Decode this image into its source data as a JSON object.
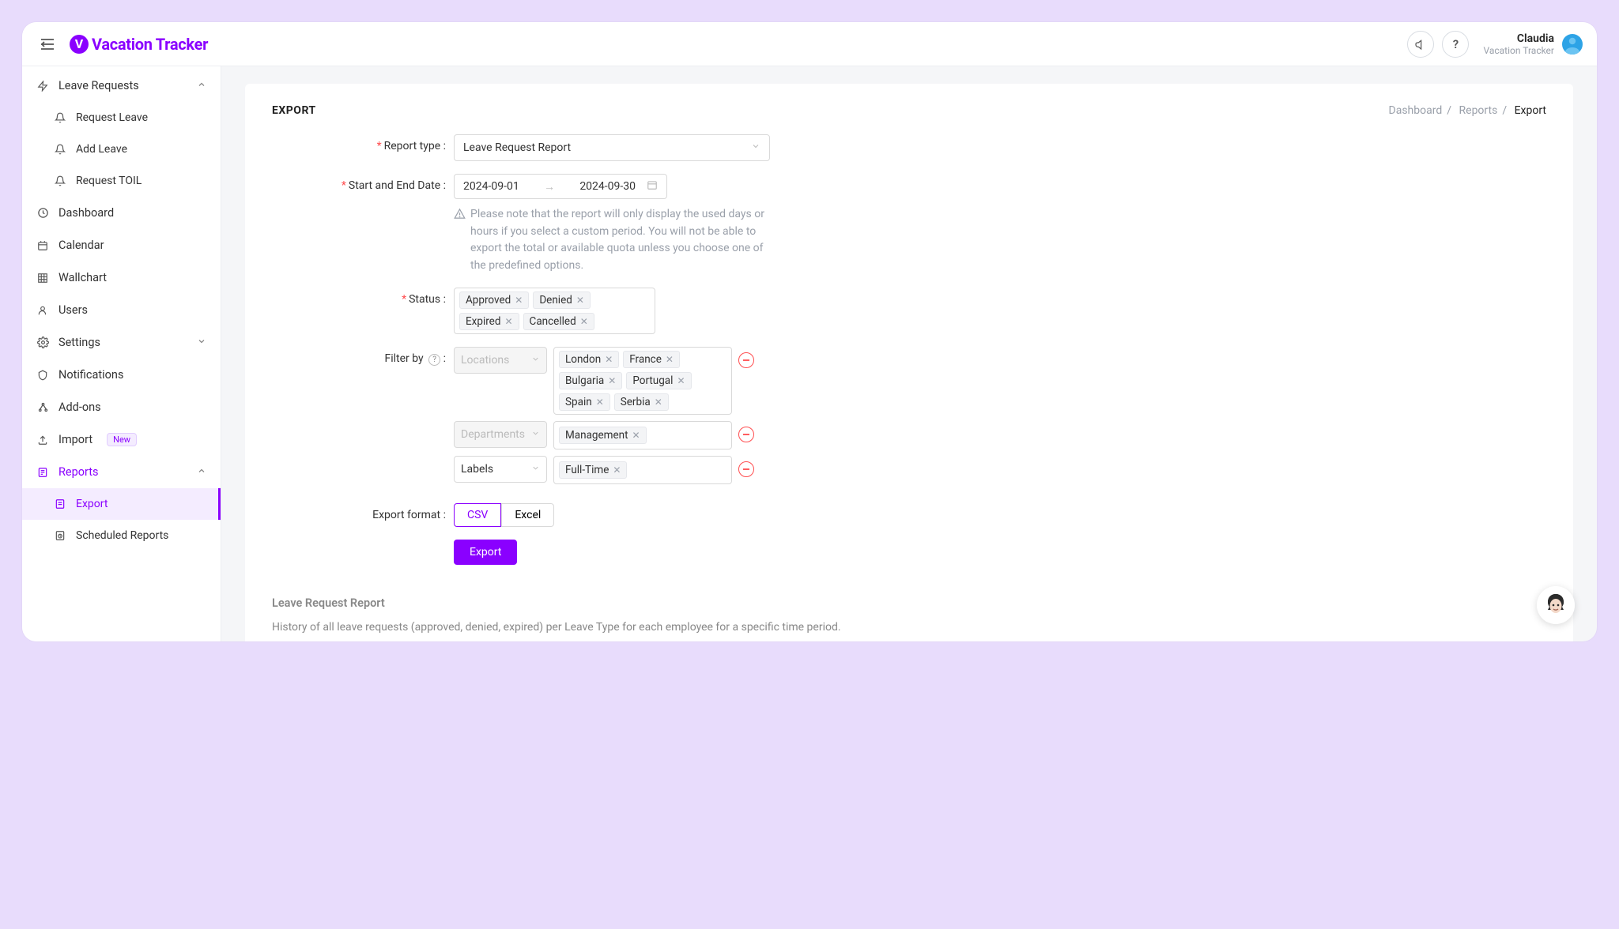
{
  "brand": {
    "name": "Vacation Tracker",
    "mark": "V"
  },
  "user": {
    "name": "Claudia",
    "sub": "Vacation Tracker"
  },
  "sidebar": {
    "leaveRequests": {
      "label": "Leave Requests"
    },
    "requestLeave": {
      "label": "Request Leave"
    },
    "addLeave": {
      "label": "Add Leave"
    },
    "requestToil": {
      "label": "Request TOIL"
    },
    "dashboard": {
      "label": "Dashboard"
    },
    "calendar": {
      "label": "Calendar"
    },
    "wallchart": {
      "label": "Wallchart"
    },
    "users": {
      "label": "Users"
    },
    "settings": {
      "label": "Settings"
    },
    "notifications": {
      "label": "Notifications"
    },
    "addons": {
      "label": "Add-ons"
    },
    "import": {
      "label": "Import",
      "badge": "New"
    },
    "reports": {
      "label": "Reports"
    },
    "export": {
      "label": "Export"
    },
    "scheduled": {
      "label": "Scheduled Reports"
    }
  },
  "breadcrumb": {
    "a": "Dashboard",
    "b": "Reports",
    "c": "Export"
  },
  "page": {
    "title": "EXPORT"
  },
  "form": {
    "reportType": {
      "label": "Report type",
      "value": "Leave Request Report"
    },
    "dateRange": {
      "label": "Start and End Date",
      "start": "2024-09-01",
      "end": "2024-09-30",
      "note": "Please note that the report will only display the used days or hours if you select a custom period. You will not be able to export the total or available quota unless you choose one of the predefined options."
    },
    "status": {
      "label": "Status",
      "tags": [
        "Approved",
        "Denied",
        "Expired",
        "Cancelled"
      ]
    },
    "filterBy": {
      "label": "Filter by"
    },
    "filters": [
      {
        "type": "Locations",
        "disabled": true,
        "values": [
          "London",
          "France",
          "Bulgaria",
          "Portugal",
          "Spain",
          "Serbia"
        ]
      },
      {
        "type": "Departments",
        "disabled": true,
        "values": [
          "Management"
        ]
      },
      {
        "type": "Labels",
        "disabled": false,
        "values": [
          "Full-Time"
        ]
      }
    ],
    "exportFormat": {
      "label": "Export format",
      "options": [
        "CSV",
        "Excel"
      ],
      "selected": "CSV"
    },
    "submit": "Export"
  },
  "info": {
    "title": "Leave Request Report",
    "desc": "History of all leave requests (approved, denied, expired) per Leave Type for each employee for a specific time period."
  }
}
